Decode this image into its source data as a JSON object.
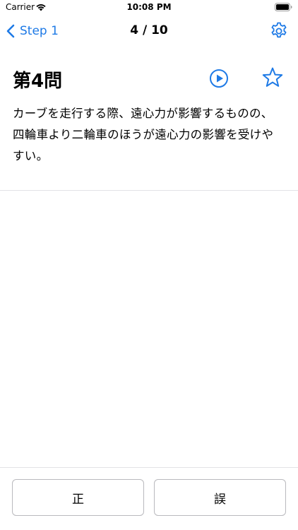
{
  "status_bar": {
    "carrier": "Carrier",
    "time": "10:08 PM",
    "wifi_icon": "wifi-icon",
    "battery_icon": "battery-icon"
  },
  "nav": {
    "back_label": "Step 1",
    "title": "4 / 10",
    "settings_icon": "gear-icon",
    "accent_color": "#1e7ae6"
  },
  "question": {
    "title": "第4問",
    "text": "カーブを走行する際、遠心力が影響するものの、四輪車より二輪車のほうが遠心力の影響を受けやすい。",
    "play_icon": "play-circle-icon",
    "bookmark_icon": "star-icon"
  },
  "answers": {
    "true_label": "正",
    "false_label": "誤"
  }
}
